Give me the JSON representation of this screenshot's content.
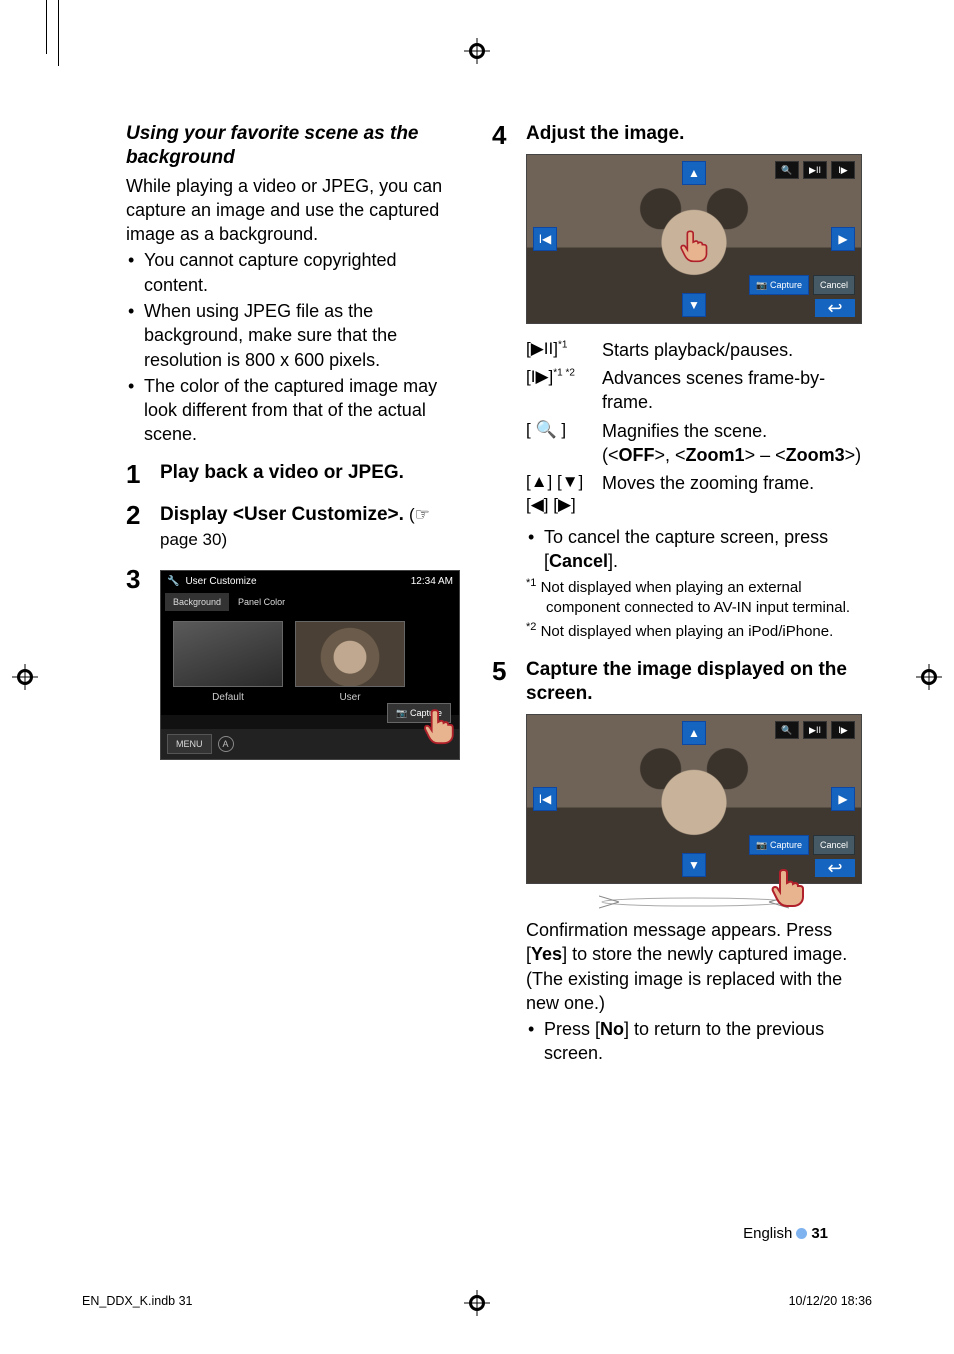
{
  "section_title": "Using your favorite scene as the background",
  "intro": "While playing a video or JPEG, you can capture an image and use the captured image as a background.",
  "intro_bullets": [
    "You cannot capture copyrighted content.",
    "When using JPEG file as the background, make sure that the resolution is 800 x 600 pixels.",
    "The color of the captured image may look different from that of the actual scene."
  ],
  "steps": {
    "s1": {
      "num": "1",
      "title": "Play back a video or JPEG."
    },
    "s2": {
      "num": "2",
      "title": "Display <User Customize>.",
      "sub": "page 30)"
    },
    "s3": {
      "num": "3"
    },
    "s4": {
      "num": "4",
      "title": "Adjust the image."
    },
    "s5": {
      "num": "5",
      "title": "Capture the image displayed on the screen."
    }
  },
  "screenshot1": {
    "title": "User Customize",
    "clock": "12:34 AM",
    "tab1": "Background",
    "tab2": "Panel Color",
    "thumb1_label": "Default",
    "thumb2_label": "User",
    "capture_btn": "📷 Capture",
    "menu_btn": "MENU"
  },
  "adjust_shot": {
    "capture_btn": "📷 Capture",
    "cancel_btn": "Cancel"
  },
  "controls": {
    "c1": {
      "key_glyph": "▶II",
      "sup": "*1",
      "desc": "Starts playback/pauses."
    },
    "c2": {
      "key_glyph": "I▶",
      "sup": "*1 *2",
      "desc": "Advances scenes frame-by-frame."
    },
    "c3": {
      "key_glyph": "🔍",
      "desc_pre": "Magnifies the scene.",
      "opts_prefix": "(<",
      "off": "OFF",
      "mid1": ">, <",
      "z1": "Zoom1",
      "mid2": "> – <",
      "z3": "Zoom3",
      "opts_suffix": ">)"
    },
    "c4": {
      "key_glyph": "[▲] [▼] [◀] [▶]",
      "desc": "Moves the zooming frame."
    }
  },
  "cancel_bullet_pre": "To cancel the capture screen, press [",
  "cancel_bullet_bold": "Cancel",
  "cancel_bullet_post": "].",
  "footnotes": {
    "f1": {
      "mark": "*1",
      "text": "Not displayed when playing an external component connected to AV-IN input terminal."
    },
    "f2": {
      "mark": "*2",
      "text": "Not displayed when playing an iPod/iPhone."
    }
  },
  "confirm_text_1": "Confirmation message appears. Press [",
  "confirm_bold_yes": "Yes",
  "confirm_text_2": "] to store the newly captured image. (The existing image is replaced with the new one.)",
  "confirm_bullet_pre": "Press [",
  "confirm_bullet_bold": "No",
  "confirm_bullet_post": "] to return to the previous screen.",
  "footer": {
    "lang": "English",
    "page": "31"
  },
  "meta": {
    "file": "EN_DDX_K.indb   31",
    "timestamp": "10/12/20   18:36"
  }
}
